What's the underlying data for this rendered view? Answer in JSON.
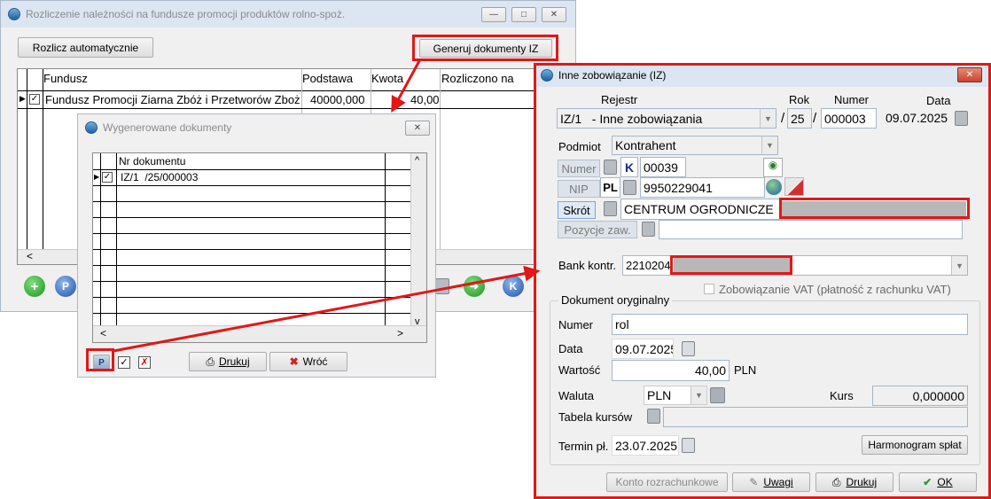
{
  "main_window": {
    "title": "Rozliczenie należności na fundusze promocji produktów rolno-spoż.",
    "btn_auto": "Rozlicz automatycznie",
    "btn_generate": "Generuj dokumenty IZ",
    "columns": [
      "Fundusz",
      "Podstawa",
      "Kwota",
      "Rozliczono na"
    ],
    "row": {
      "fundusz": "Fundusz Promocji Ziarna Zbóż i Przetworów Zboż",
      "podstawa": "40000,000",
      "kwota": "40,00"
    },
    "scroll_left": "<",
    "scroll_right": ">"
  },
  "gen_window": {
    "title": "Wygenerowane dokumenty",
    "column": "Nr dokumentu",
    "rows": [
      "IZ/1  /25/000003"
    ],
    "btn_print": "Drukuj",
    "btn_back": "Wróć",
    "p_label": "P",
    "scroll_left": "<",
    "scroll_right": ">",
    "scroll_up": "^",
    "scroll_down": "v"
  },
  "iz_window": {
    "title": "Inne zobowiązanie (IZ)",
    "labels": {
      "rejestr": "Rejestr",
      "rok": "Rok",
      "numer_hdr": "Numer",
      "data_hdr": "Data",
      "podmiot": "Podmiot",
      "numer": "Numer",
      "nip": "NIP",
      "skrot": "Skrót",
      "pozycje": "Pozycje zaw.",
      "bank": "Bank kontr.",
      "vat": "Zobowiązanie VAT (płatność z rachunku VAT)",
      "dok_oryg": "Dokument oryginalny",
      "d_numer": "Numer",
      "d_data": "Data",
      "d_wartosc": "Wartość",
      "waluta": "Waluta",
      "kurs": "Kurs",
      "tabela": "Tabela kursów",
      "termin": "Termin pł.",
      "slash1": "/",
      "slash2": "/",
      "pln_unit": "PLN"
    },
    "values": {
      "rejestr": "IZ/1   - Inne zobowiązania",
      "rok": "25",
      "numer": "000003",
      "data": "09.07.2025",
      "podmiot": "Kontrahent",
      "k_prefix": "K",
      "kontrahent_numer": "00039",
      "pl_prefix": "PL",
      "nip": "9950229041",
      "skrot": "CENTRUM OGRODNICZE",
      "bank": "2210204",
      "d_numer": "rol",
      "d_data": "09.07.2025",
      "d_wartosc": "40,00",
      "waluta": "PLN",
      "kurs": "0,000000",
      "termin": "23.07.2025"
    },
    "buttons": {
      "harmonogram": "Harmonogram spłat",
      "konto": "Konto rozrachunkowe",
      "uwagi": "Uwagi",
      "drukuj": "Drukuj",
      "ok": "OK"
    }
  },
  "colors": {
    "highlight": "#e01818",
    "window_bg": "#f0f0f0",
    "titlebar": "#dbe6f2"
  }
}
